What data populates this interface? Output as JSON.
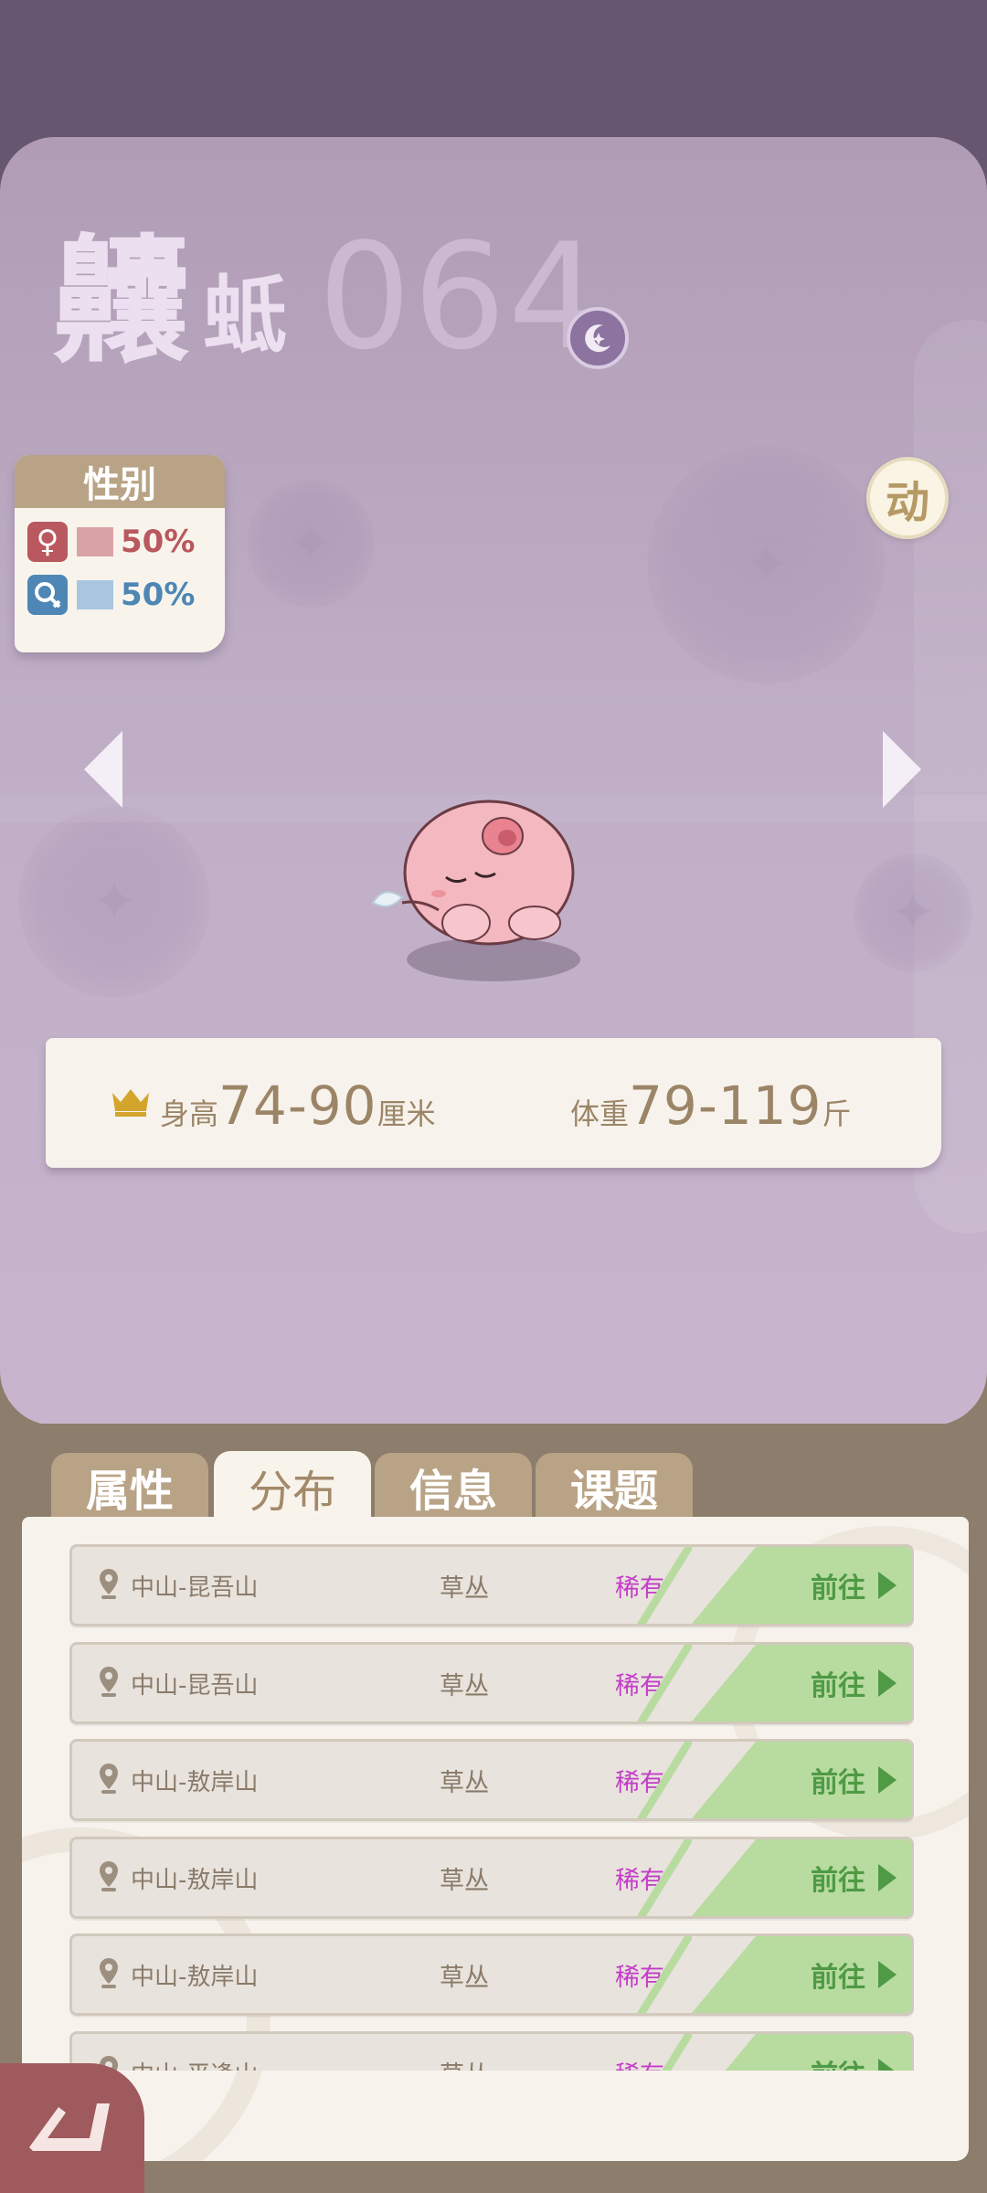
{
  "pokemon": {
    "name_big": "齉",
    "name_small": "蚳",
    "number": "064",
    "type_icon": "moon-star-icon"
  },
  "gender": {
    "title": "性别",
    "female": {
      "icon": "♀",
      "percent": "50%",
      "color": "#d9a3a6"
    },
    "male": {
      "icon": "⚲",
      "percent": "50%",
      "color": "#a8c6e0"
    }
  },
  "motion_button": "动",
  "stats": {
    "height_label": "身高",
    "height_value": "74-90",
    "height_unit": "厘米",
    "weight_label": "体重",
    "weight_value": "79-119",
    "weight_unit": "斤"
  },
  "tabs": [
    {
      "label": "属性",
      "active": false
    },
    {
      "label": "分布",
      "active": true
    },
    {
      "label": "信息",
      "active": false
    },
    {
      "label": "课题",
      "active": false
    }
  ],
  "locations": [
    {
      "name": "中山-昆吾山",
      "habitat": "草丛",
      "rarity": "稀有",
      "action": "前往"
    },
    {
      "name": "中山-昆吾山",
      "habitat": "草丛",
      "rarity": "稀有",
      "action": "前往"
    },
    {
      "name": "中山-敖岸山",
      "habitat": "草丛",
      "rarity": "稀有",
      "action": "前往"
    },
    {
      "name": "中山-敖岸山",
      "habitat": "草丛",
      "rarity": "稀有",
      "action": "前往"
    },
    {
      "name": "中山-敖岸山",
      "habitat": "草丛",
      "rarity": "稀有",
      "action": "前往"
    },
    {
      "name": "中山-平逢山",
      "habitat": "草丛",
      "rarity": "稀有",
      "action": "前往"
    }
  ],
  "colors": {
    "accent_green": "#4f9a45",
    "rarity_magenta": "#c43cc9",
    "tab_tan": "#b9a386",
    "hero_purple": "#bfaec6"
  }
}
